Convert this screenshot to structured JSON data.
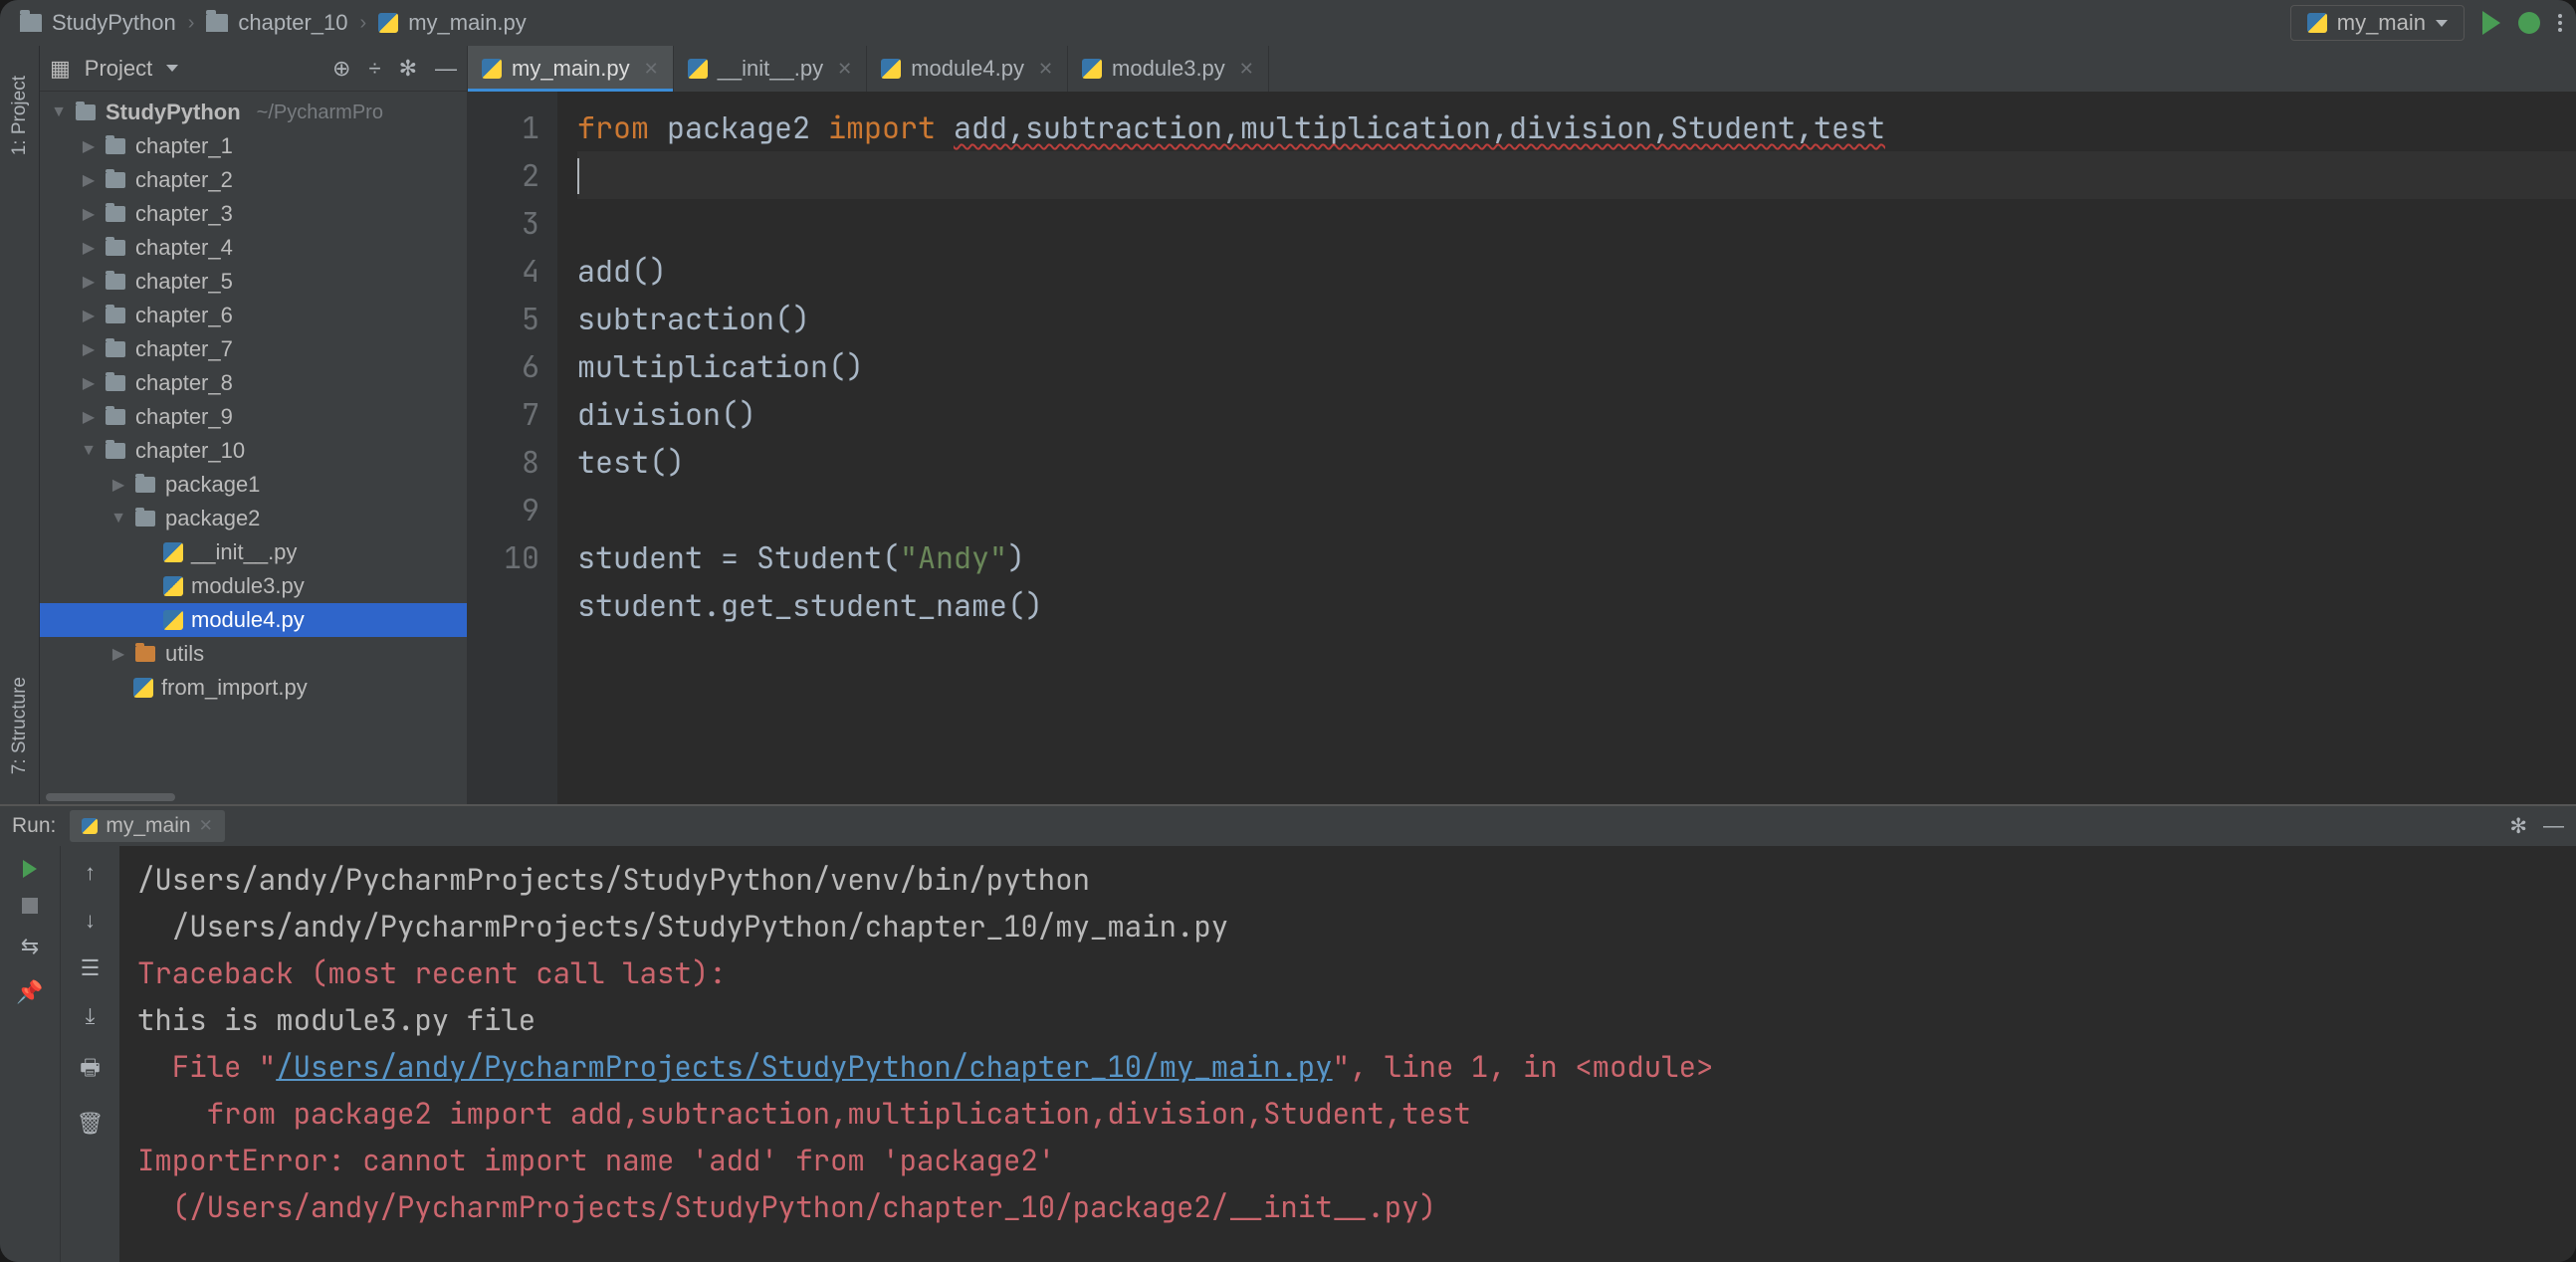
{
  "breadcrumb": [
    "StudyPython",
    "chapter_10",
    "my_main.py"
  ],
  "run_config": "my_main",
  "sidebar_labels": {
    "project": "1: Project",
    "structure": "7: Structure"
  },
  "project_panel": {
    "title": "Project",
    "root": {
      "name": "StudyPython",
      "hint": "~/PycharmPro"
    },
    "chapters": [
      "chapter_1",
      "chapter_2",
      "chapter_3",
      "chapter_4",
      "chapter_5",
      "chapter_6",
      "chapter_7",
      "chapter_8",
      "chapter_9"
    ],
    "chapter10": {
      "name": "chapter_10",
      "package1": "package1",
      "package2": {
        "name": "package2",
        "files": [
          "__init__.py",
          "module3.py",
          "module4.py"
        ]
      },
      "utils": "utils",
      "from_import": "from_import.py"
    }
  },
  "tabs": [
    {
      "name": "my_main.py",
      "active": true
    },
    {
      "name": "__init__.py",
      "active": false
    },
    {
      "name": "module4.py",
      "active": false
    },
    {
      "name": "module3.py",
      "active": false
    }
  ],
  "code": {
    "line_count": 10,
    "l1_from": "from",
    "l1_pkg": "package2",
    "l1_import": "import",
    "l1_names": "add,subtraction,multiplication,division,Student,test",
    "l3": "add()",
    "l4": "subtraction()",
    "l5": "multiplication()",
    "l6": "division()",
    "l7": "test()",
    "l9": "student = Student(",
    "l9_str": "\"Andy\"",
    "l9_end": ")",
    "l10": "student.get_student_name()"
  },
  "run": {
    "label": "Run:",
    "tab": "my_main",
    "out1": "/Users/andy/PycharmProjects/StudyPython/venv/bin/python",
    "out2": "  /Users/andy/PycharmProjects/StudyPython/chapter_10/my_main.py",
    "tb": "Traceback (most recent call last):",
    "mod3": "this is module3.py file",
    "file_prefix": "  File \"",
    "file_link": "/Users/andy/PycharmProjects/StudyPython/chapter_10/my_main.py",
    "file_suffix": "\", line 1, in <module>",
    "src": "    from package2 import add,subtraction,multiplication,division,Student,test",
    "err": "ImportError: cannot import name 'add' from 'package2'",
    "loc": "  (/Users/andy/PycharmProjects/StudyPython/chapter_10/package2/__init__.py)"
  }
}
